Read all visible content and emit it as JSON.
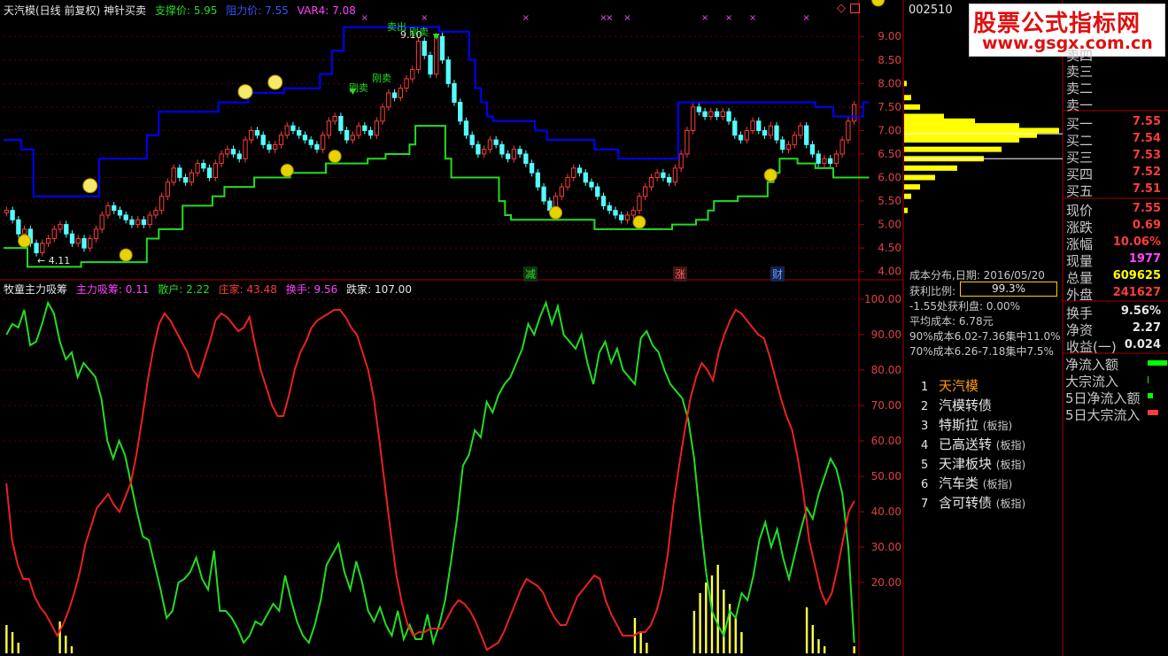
{
  "top_header": {
    "title": "天汽模(日线 前复权)",
    "indicator_name": "神针买卖",
    "support": "支撑价: 5.95",
    "resist": "阻力价: 7.55",
    "var4": "VAR4: 7.08"
  },
  "lower_header": {
    "title": "牧童主力吸筹",
    "main": "主力吸筹: 0.11",
    "retail": "散户: 2.22",
    "banker": "庄家: 43.48",
    "turnover": "换手: 9.56",
    "jump": "跌家: 107.00"
  },
  "price_markers": {
    "low_label": "← 4.11",
    "high_label": "9.10",
    "sell_label": "卖出",
    "buy_labels": [
      "刚卖",
      "刚卖",
      "刚卖"
    ],
    "event_labels": [
      "减",
      "涨",
      "财"
    ]
  },
  "stock_code": "002510",
  "watermark": {
    "line1": "股票公式指标网",
    "line2": "www.gsgx.com.cn"
  },
  "orderbook": {
    "sell_labels": [
      "卖四",
      "卖三",
      "卖二",
      "卖一"
    ],
    "buy": [
      {
        "label": "买一",
        "value": "7.55"
      },
      {
        "label": "买二",
        "value": "7.54"
      },
      {
        "label": "买三",
        "value": "7.53"
      },
      {
        "label": "买四",
        "value": "7.52"
      },
      {
        "label": "买五",
        "value": "7.51"
      }
    ]
  },
  "quote": [
    {
      "label": "现价",
      "value": "7.55",
      "color": "#ff3c3c"
    },
    {
      "label": "涨跌",
      "value": "0.69",
      "color": "#ff3c3c"
    },
    {
      "label": "涨幅",
      "value": "10.06%",
      "color": "#ff3c3c"
    },
    {
      "label": "现量",
      "value": "1977",
      "color": "#ff44ff"
    },
    {
      "label": "总量",
      "value": "609625",
      "color": "#ffff00"
    },
    {
      "label": "外盘",
      "value": "241627",
      "color": "#ff3c3c"
    }
  ],
  "stats": [
    {
      "label": "换手",
      "value": "9.56%"
    },
    {
      "label": "净资",
      "value": "2.27"
    },
    {
      "label": "收益(一)",
      "value": "0.024"
    }
  ],
  "flows": [
    {
      "label": "净流入额",
      "color": "#00ff00"
    },
    {
      "label": "大宗流入",
      "color": "#00ff00"
    },
    {
      "label": "5日净流入额",
      "color": "#00ff00"
    },
    {
      "label": "5日大宗流入",
      "color": "#ff3c3c"
    }
  ],
  "cost": {
    "date": "成本分布,日期: 2016/05/20",
    "profit_label": "获利比例:",
    "profit_value": "99.3%",
    "lines": [
      "-1.55处获利盘: 0.00%",
      "平均成本: 6.78元",
      "90%成本6.02-7.36集中11.0%",
      "70%成本6.26-7.18集中7.5%"
    ]
  },
  "related": [
    {
      "idx": "1",
      "name": "天汽模",
      "sub": "",
      "color": "#ff9900"
    },
    {
      "idx": "2",
      "name": "汽模转债",
      "sub": "",
      "color": "#e6e6e6"
    },
    {
      "idx": "3",
      "name": "特斯拉",
      "sub": "(板指)",
      "color": "#e6e6e6"
    },
    {
      "idx": "4",
      "name": "已高送转",
      "sub": "(板指)",
      "color": "#e6e6e6"
    },
    {
      "idx": "5",
      "name": "天津板块",
      "sub": "(板指)",
      "color": "#e6e6e6"
    },
    {
      "idx": "6",
      "name": "汽车类",
      "sub": "(板指)",
      "color": "#e6e6e6"
    },
    {
      "idx": "7",
      "name": "含可转债",
      "sub": "(板指)",
      "color": "#e6e6e6"
    }
  ],
  "chart_data": [
    {
      "type": "candlestick",
      "title": "天汽模(日线 前复权)",
      "ylim": [
        3.9,
        9.4
      ],
      "yticks": [
        4.0,
        4.5,
        5.0,
        5.5,
        6.0,
        6.5,
        7.0,
        7.5,
        8.0,
        8.5,
        9.0
      ],
      "grid": true,
      "close": [
        5.3,
        5.1,
        4.8,
        4.9,
        4.6,
        4.4,
        4.6,
        4.7,
        4.9,
        5.0,
        4.8,
        4.6,
        4.7,
        4.5,
        4.7,
        4.9,
        5.2,
        5.4,
        5.3,
        5.2,
        5.1,
        5.0,
        5.1,
        5.0,
        5.2,
        5.3,
        5.6,
        5.9,
        6.2,
        6.0,
        5.9,
        6.1,
        6.3,
        6.2,
        6.0,
        6.3,
        6.5,
        6.6,
        6.5,
        6.4,
        6.8,
        7.0,
        6.9,
        6.7,
        6.6,
        6.7,
        6.9,
        7.1,
        7.0,
        6.9,
        6.8,
        6.7,
        6.6,
        6.9,
        7.2,
        7.3,
        7.0,
        6.8,
        6.9,
        7.1,
        7.0,
        6.9,
        7.2,
        7.5,
        7.8,
        7.7,
        7.9,
        8.1,
        8.3,
        8.9,
        8.6,
        8.2,
        9.0,
        8.5,
        8.0,
        7.6,
        7.2,
        6.9,
        6.7,
        6.5,
        6.6,
        6.8,
        6.7,
        6.5,
        6.4,
        6.6,
        6.5,
        6.3,
        6.1,
        5.8,
        5.5,
        5.3,
        5.6,
        5.8,
        6.0,
        6.2,
        6.1,
        5.9,
        5.8,
        5.6,
        5.4,
        5.3,
        5.2,
        5.1,
        5.2,
        5.3,
        5.6,
        5.8,
        6.0,
        6.1,
        6.0,
        5.9,
        6.2,
        6.5,
        7.0,
        7.5,
        7.4,
        7.3,
        7.4,
        7.3,
        7.4,
        7.2,
        6.9,
        6.8,
        7.0,
        7.2,
        7.0,
        6.9,
        7.1,
        6.8,
        6.6,
        6.7,
        6.9,
        7.1,
        6.7,
        6.5,
        6.3,
        6.4,
        6.3,
        6.5,
        6.8,
        7.2,
        7.55
      ],
      "series": [
        {
          "name": "阻力价",
          "color": "#0000ff",
          "values": [
            6.8,
            6.8,
            6.8,
            6.6,
            6.6,
            5.6,
            5.6,
            5.6,
            5.6,
            5.6,
            5.6,
            5.6,
            5.6,
            5.6,
            5.6,
            5.6,
            6.4,
            6.4,
            6.4,
            6.4,
            6.4,
            6.4,
            6.4,
            6.4,
            6.9,
            6.9,
            7.4,
            7.4,
            7.4,
            7.4,
            7.4,
            7.4,
            7.4,
            7.4,
            7.4,
            7.4,
            7.6,
            7.6,
            7.6,
            7.6,
            7.6,
            7.8,
            7.8,
            7.8,
            7.8,
            7.8,
            7.8,
            7.9,
            7.9,
            7.9,
            7.9,
            7.9,
            7.9,
            8.2,
            8.2,
            8.7,
            8.7,
            9.2,
            9.2,
            9.2,
            9.2,
            9.2,
            9.2,
            9.2,
            9.2,
            9.2,
            9.2,
            9.2,
            9.2,
            9.2,
            9.2,
            9.2,
            9.2,
            9.1,
            9.1,
            9.1,
            9.1,
            9.1,
            8.5,
            7.9,
            7.6,
            7.3,
            7.2,
            7.2,
            7.2,
            7.2,
            7.2,
            7.2,
            7.2,
            7.0,
            7.0,
            6.8,
            6.8,
            6.8,
            6.8,
            6.8,
            6.8,
            6.8,
            6.8,
            6.6,
            6.6,
            6.6,
            6.6,
            6.4,
            6.4,
            6.4,
            6.4,
            6.4,
            6.4,
            6.4,
            6.4,
            6.4,
            6.4,
            7.6,
            7.6,
            7.6,
            7.6,
            7.6,
            7.6,
            7.6,
            7.6,
            7.6,
            7.6,
            7.6,
            7.6,
            7.6,
            7.6,
            7.6,
            7.6,
            7.6,
            7.6,
            7.6,
            7.6,
            7.6,
            7.6,
            7.6,
            7.5,
            7.5,
            7.5,
            7.3,
            7.3,
            7.3,
            7.3,
            7.3,
            7.6
          ]
        },
        {
          "name": "支撑价",
          "color": "#22dd22",
          "values": [
            4.5,
            4.5,
            4.5,
            4.5,
            4.1,
            4.1,
            4.1,
            4.1,
            4.1,
            4.1,
            4.1,
            4.1,
            4.1,
            4.2,
            4.2,
            4.2,
            4.2,
            4.2,
            4.2,
            4.2,
            4.2,
            4.2,
            4.2,
            4.2,
            4.7,
            4.7,
            4.9,
            4.9,
            4.9,
            4.9,
            5.4,
            5.4,
            5.4,
            5.4,
            5.4,
            5.6,
            5.6,
            5.8,
            5.8,
            5.8,
            5.8,
            5.8,
            6.0,
            6.0,
            6.0,
            6.0,
            6.0,
            6.0,
            6.1,
            6.1,
            6.1,
            6.1,
            6.1,
            6.1,
            6.3,
            6.3,
            6.3,
            6.3,
            6.3,
            6.3,
            6.3,
            6.4,
            6.4,
            6.4,
            6.5,
            6.5,
            6.5,
            6.5,
            6.7,
            7.1,
            7.1,
            7.1,
            7.1,
            7.1,
            6.4,
            6.0,
            6.0,
            6.0,
            6.0,
            6.0,
            6.0,
            6.0,
            6.0,
            5.5,
            5.2,
            5.1,
            5.1,
            5.1,
            5.1,
            5.1,
            5.1,
            5.1,
            5.1,
            5.1,
            5.1,
            5.1,
            5.1,
            5.1,
            5.1,
            4.9,
            4.9,
            4.9,
            4.9,
            4.9,
            4.9,
            4.9,
            4.9,
            4.9,
            4.9,
            4.9,
            4.9,
            4.9,
            5.0,
            5.0,
            5.0,
            5.0,
            5.1,
            5.1,
            5.3,
            5.5,
            5.5,
            5.5,
            5.5,
            5.6,
            5.6,
            5.6,
            5.6,
            5.6,
            5.9,
            6.1,
            6.4,
            6.4,
            6.4,
            6.3,
            6.3,
            6.3,
            6.2,
            6.2,
            6.2,
            6.0,
            6.0,
            6.0,
            6.0,
            6.0,
            6.0
          ]
        }
      ]
    },
    {
      "type": "line",
      "title": "牧童主力吸筹",
      "ylim": [
        0,
        103
      ],
      "yticks": [
        20,
        30,
        40,
        50,
        60,
        70,
        80,
        90,
        100
      ],
      "grid": true,
      "series": [
        {
          "name": "散户",
          "color": "#22dd22",
          "values": [
            90,
            93,
            92,
            97,
            87,
            88,
            93,
            99,
            96,
            88,
            83,
            85,
            78,
            82,
            80,
            78,
            72,
            60,
            55,
            60,
            56,
            48,
            40,
            33,
            32,
            25,
            18,
            10,
            12,
            20,
            21,
            23,
            27,
            21,
            18,
            29,
            12,
            12,
            10,
            7,
            3,
            5,
            9,
            8,
            11,
            14,
            12,
            22,
            15,
            9,
            5,
            3,
            8,
            15,
            25,
            28,
            31,
            23,
            18,
            26,
            20,
            12,
            9,
            13,
            8,
            5,
            12,
            4,
            8,
            4,
            4,
            11,
            3,
            8,
            15,
            26,
            38,
            53,
            56,
            63,
            61,
            71,
            68,
            73,
            76,
            78,
            82,
            86,
            93,
            90,
            95,
            99,
            93,
            98,
            90,
            88,
            86,
            90,
            82,
            76,
            85,
            88,
            82,
            86,
            80,
            78,
            76,
            89,
            91,
            87,
            85,
            80,
            76,
            74,
            72,
            66,
            55,
            38,
            23,
            12,
            8,
            5,
            12,
            10,
            17,
            15,
            22,
            32,
            37,
            30,
            35,
            27,
            21,
            28,
            35,
            41,
            38,
            45,
            50,
            55,
            52,
            45,
            30,
            3
          ]
        },
        {
          "name": "庄家",
          "color": "#ee2020",
          "values": [
            48,
            32,
            25,
            21,
            21,
            16,
            13,
            11,
            8,
            5,
            8,
            12,
            17,
            23,
            31,
            36,
            41,
            43,
            45,
            42,
            40,
            44,
            48,
            56,
            66,
            77,
            86,
            93,
            96,
            94,
            91,
            88,
            85,
            80,
            78,
            83,
            88,
            94,
            96,
            95,
            93,
            91,
            92,
            95,
            87,
            80,
            75,
            70,
            67,
            67,
            73,
            80,
            85,
            88,
            92,
            94,
            95,
            96,
            97,
            97,
            95,
            92,
            90,
            85,
            80,
            72,
            60,
            47,
            34,
            22,
            14,
            8,
            5,
            6,
            6,
            7,
            7,
            7,
            10,
            13,
            15,
            14,
            12,
            9,
            5,
            1,
            2,
            3,
            6,
            10,
            14,
            18,
            21,
            20,
            19,
            17,
            13,
            10,
            8,
            8,
            12,
            16,
            18,
            20,
            22,
            21,
            15,
            11,
            8,
            5,
            5,
            5,
            6,
            6,
            8,
            12,
            18,
            28,
            42,
            53,
            63,
            72,
            78,
            82,
            80,
            77,
            85,
            90,
            94,
            97,
            96,
            94,
            92,
            90,
            89,
            84,
            78,
            72,
            67,
            63,
            55,
            45,
            32,
            25,
            18,
            14,
            17,
            24,
            32,
            40,
            43
          ]
        },
        {
          "name": "主力吸筹",
          "color": "#ffff44",
          "type": "bar",
          "values": [
            2,
            2,
            1,
            1,
            0,
            0,
            0,
            0,
            0,
            0,
            0,
            0,
            0,
            0,
            0,
            0,
            0,
            0,
            0,
            0,
            0,
            0,
            0,
            0,
            0,
            0,
            0,
            0,
            0,
            0,
            0,
            0,
            0,
            0,
            0,
            0,
            0,
            0,
            0,
            0,
            0,
            0,
            0,
            0,
            0,
            0,
            0,
            0,
            0,
            0,
            0,
            0,
            0,
            0,
            0,
            0,
            0,
            0,
            0,
            0,
            0,
            0,
            0,
            0,
            0,
            0,
            0,
            0,
            0,
            0,
            0,
            0,
            0,
            0,
            0,
            0,
            0,
            0,
            0,
            0,
            0,
            0,
            0,
            0,
            0,
            0,
            0,
            0,
            0,
            0,
            0,
            0,
            0,
            0,
            0,
            0,
            0,
            0,
            0,
            0,
            0,
            0,
            0,
            0,
            0,
            0,
            0,
            0,
            0,
            0,
            0,
            0,
            0,
            0,
            0,
            0,
            0,
            0,
            0,
            0,
            0,
            0,
            0,
            0,
            0,
            0,
            0,
            0,
            0,
            0,
            0,
            0,
            0,
            0,
            0,
            0,
            0,
            0,
            0,
            0,
            0,
            0,
            0,
            0,
            0,
            0,
            0,
            0,
            0,
            0,
            0
          ]
        }
      ]
    }
  ]
}
